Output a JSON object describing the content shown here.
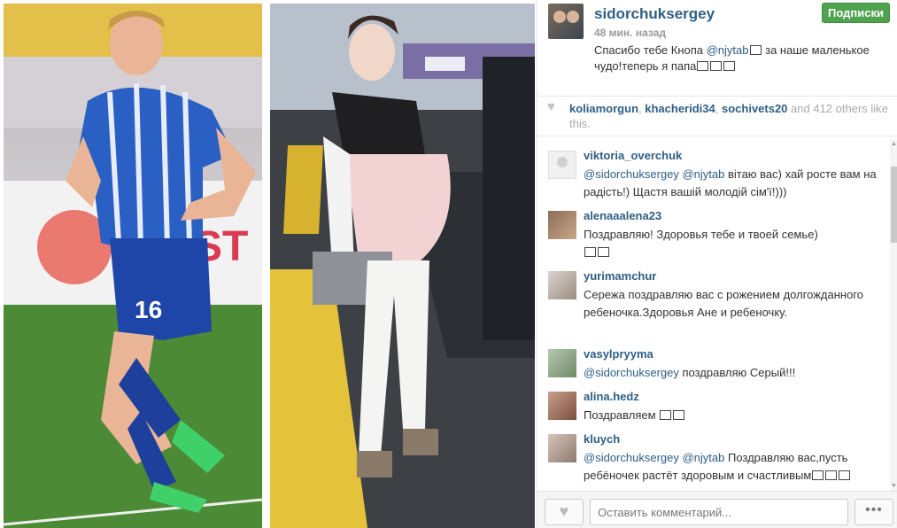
{
  "post": {
    "username": "sidorchuksergey",
    "time": "48 мин. назад",
    "follow_label": "Подписки",
    "caption_before": "Спасибо тебе Кнопа ",
    "caption_mention": "@njytab",
    "caption_after": " за наше маленькое чудо!теперь я папа"
  },
  "likes": {
    "user1": "koliamorgun",
    "user2": "khacheridi34",
    "user3": "sochivets20",
    "and": " and ",
    "count": "412",
    "others": " others like this."
  },
  "comments": [
    {
      "user": "viktoria_overchuk",
      "mention": "@sidorchuksergey @njytab",
      "text": " вітаю вас) хай росте вам на радість!) Щастя вашій молодій сім'ї!)))"
    },
    {
      "user": "alenaaalena23",
      "mention": "",
      "text": "Поздравляю! Здоровья тебе и твоей семье)"
    },
    {
      "user": "yurimamchur",
      "mention": "",
      "text": "Сережа поздравляю вас с рожением долгожданного ребеночка.Здоровья Ане и ребеночку."
    },
    {
      "user": "vasylpryyma",
      "mention": "@sidorchuksergey",
      "text": " поздравляю Серый!!!"
    },
    {
      "user": "alina.hedz",
      "mention": "",
      "text": "Поздравляем"
    },
    {
      "user": "kluych",
      "mention": "@sidorchuksergey @njytab",
      "text": " Поздравляю вас,пусть ребёночек растёт здоровым и счастливым"
    }
  ],
  "footer": {
    "comment_placeholder": "Оставить комментарий...",
    "more_label": "•••"
  },
  "colors": {
    "link": "#2e5e86",
    "follow_button": "#4fa34f"
  },
  "icons": [
    "heart-icon",
    "like-heart-icon",
    "more-dots-icon",
    "scroll-up-icon",
    "scroll-down-icon"
  ]
}
